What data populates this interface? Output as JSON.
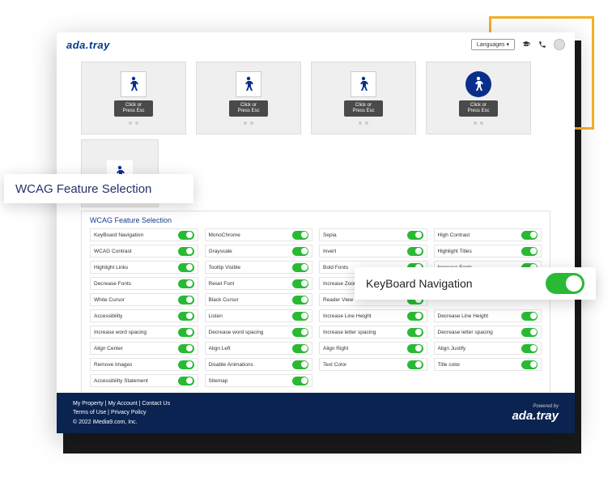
{
  "brand": "ada.tray",
  "header": {
    "languages_label": "Languages ▾"
  },
  "icon_cards": {
    "badge_line1": "Click or",
    "badge_line2": "Press Esc"
  },
  "callouts": {
    "wcag_title": "WCAG Feature Selection",
    "keyboard_nav": "KeyBoard Navigation"
  },
  "wcag_section_title": "WCAG Feature Selection",
  "features": {
    "col1": [
      "KeyBoard Navigation",
      "WCAG Contrast",
      "Highlight Links",
      "Decrease Fonts",
      "White Cursor",
      "Accessibility",
      "Increase word spacing",
      "Align Center",
      "Remove Images",
      "Accessibility Statement"
    ],
    "col2": [
      "MonoChrome",
      "Grayscale",
      "Tooltip Visible",
      "Reset Font",
      "Black Cursor",
      "Listen",
      "Decrease word spacing",
      "Align Left",
      "Disable Animations",
      "Sitemap"
    ],
    "col3": [
      "Sepia",
      "Invert",
      "Bold Fonts",
      "Increase Zoom",
      "Reader View",
      "Increase Line Height",
      "Increase letter spacing",
      "Align Right",
      "Text Color"
    ],
    "col4": [
      "High Contrast",
      "Highlight Titles",
      "Increase Fonts",
      "",
      "",
      "Decrease Line Height",
      "Decrease letter spacing",
      "Align Justify",
      "Title color"
    ]
  },
  "footer": {
    "links": "My Property | My Account | Contact Us",
    "legal": "Terms of Use | Privacy Policy",
    "copyright": "© 2022 iMedia9.com, Inc.",
    "powered_by": "Powered by",
    "brand": "ada.tray"
  }
}
